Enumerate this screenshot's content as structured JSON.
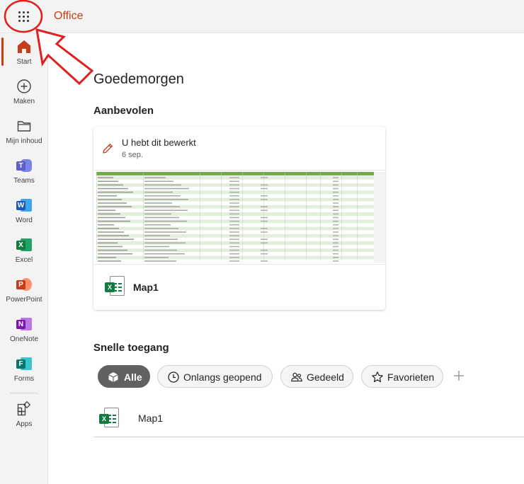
{
  "header": {
    "brand": "Office"
  },
  "rail": {
    "items": [
      {
        "label": "Start"
      },
      {
        "label": "Maken"
      },
      {
        "label": "Mijn inhoud"
      },
      {
        "label": "Teams"
      },
      {
        "label": "Word"
      },
      {
        "label": "Excel"
      },
      {
        "label": "PowerPoint"
      },
      {
        "label": "OneNote"
      },
      {
        "label": "Forms"
      },
      {
        "label": "Apps"
      }
    ]
  },
  "main": {
    "greeting": "Goedemorgen",
    "recommended": {
      "title": "Aanbevolen",
      "card": {
        "activity": "U hebt dit bewerkt",
        "date": "6 sep.",
        "file_name": "Map1"
      }
    },
    "quick_access": {
      "title": "Snelle toegang",
      "filters": [
        {
          "label": "Alle",
          "active": true
        },
        {
          "label": "Onlangs geopend",
          "active": false
        },
        {
          "label": "Gedeeld",
          "active": false
        },
        {
          "label": "Favorieten",
          "active": false
        }
      ],
      "files": [
        {
          "name": "Map1"
        }
      ]
    }
  },
  "colors": {
    "accent": "#c43e1c",
    "excel": "#107c41",
    "word": "#185abd",
    "powerpoint": "#c43e1c",
    "onenote": "#7719aa",
    "teams": "#5b5fc7",
    "forms": "#077568",
    "annotation": "#e02020"
  }
}
